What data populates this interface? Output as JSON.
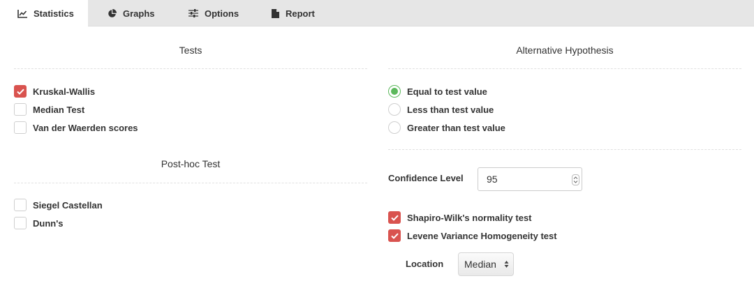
{
  "tabs": [
    {
      "label": "Statistics",
      "icon": "line-chart-icon",
      "active": true
    },
    {
      "label": "Graphs",
      "icon": "pie-chart-icon",
      "active": false
    },
    {
      "label": "Options",
      "icon": "sliders-icon",
      "active": false
    },
    {
      "label": "Report",
      "icon": "file-icon",
      "active": false
    }
  ],
  "tests": {
    "title": "Tests",
    "items": [
      {
        "label": "Kruskal-Wallis",
        "checked": true
      },
      {
        "label": "Median Test",
        "checked": false
      },
      {
        "label": "Van der Waerden scores",
        "checked": false
      }
    ]
  },
  "posthoc": {
    "title": "Post-hoc Test",
    "items": [
      {
        "label": "Siegel Castellan",
        "checked": false
      },
      {
        "label": "Dunn's",
        "checked": false
      }
    ]
  },
  "alternative": {
    "title": "Alternative Hypothesis",
    "options": [
      {
        "label": "Equal to test value",
        "selected": true
      },
      {
        "label": "Less than test value",
        "selected": false
      },
      {
        "label": "Greater than test value",
        "selected": false
      }
    ]
  },
  "confidence": {
    "label": "Confidence Level",
    "value": "95"
  },
  "assumptions": {
    "items": [
      {
        "label": "Shapiro-Wilk's normality test",
        "checked": true
      },
      {
        "label": "Levene Variance Homogeneity test",
        "checked": true
      }
    ],
    "location_label": "Location",
    "location_value": "Median"
  },
  "colors": {
    "checkbox_checked": "#d9534f",
    "radio_checked": "#5cb85c",
    "tabbar_bg": "#e6e6e6"
  }
}
